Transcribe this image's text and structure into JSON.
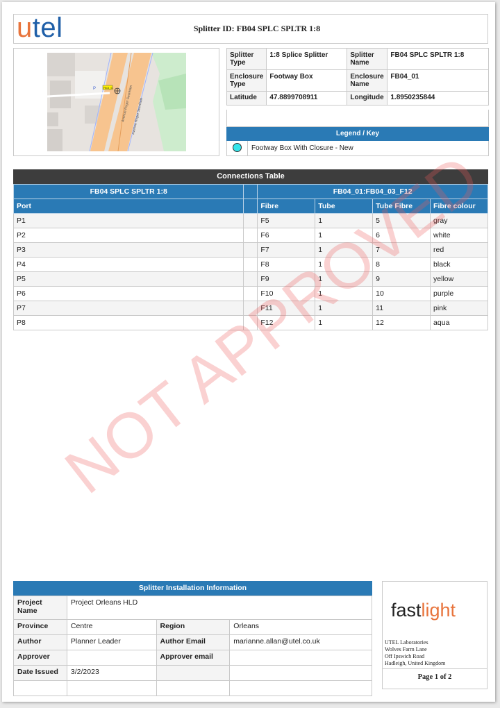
{
  "header": {
    "logo_u": "u",
    "logo_rest": "tel",
    "title": "Splitter ID: FB04 SPLC SPLTR 1:8"
  },
  "details": {
    "splitter_type_label": "Splitter Type",
    "splitter_type_value": "1:8 Splice Splitter",
    "splitter_name_label": "Splitter Name",
    "splitter_name_value": "FB04 SPLC SPLTR 1:8",
    "enclosure_type_label": "Enclosure Type",
    "enclosure_type_value": "Footway Box",
    "enclosure_name_label": "Enclosure Name",
    "enclosure_name_value": "FB04_01",
    "latitude_label": "Latitude",
    "latitude_value": "47.8899708911",
    "longitude_label": "Longitude",
    "longitude_value": "1.8950235844"
  },
  "legend": {
    "title": "Legend / Key",
    "item": "Footway Box With Closure - New",
    "symbol_color": "#35e5ea"
  },
  "connections": {
    "title": "Connections Table",
    "left_group": "FB04 SPLC SPLTR 1:8",
    "right_group": "FB04_01:FB04_03_F12",
    "columns": [
      "Port",
      "Fibre",
      "Tube",
      "Tube Fibre",
      "Fibre colour"
    ],
    "rows": [
      [
        "P1",
        "F5",
        "1",
        "5",
        "gray"
      ],
      [
        "P2",
        "F6",
        "1",
        "6",
        "white"
      ],
      [
        "P3",
        "F7",
        "1",
        "7",
        "red"
      ],
      [
        "P4",
        "F8",
        "1",
        "8",
        "black"
      ],
      [
        "P5",
        "F9",
        "1",
        "9",
        "yellow"
      ],
      [
        "P6",
        "F10",
        "1",
        "10",
        "purple"
      ],
      [
        "P7",
        "F11",
        "1",
        "11",
        "pink"
      ],
      [
        "P8",
        "F12",
        "1",
        "12",
        "aqua"
      ]
    ]
  },
  "installation": {
    "title": "Splitter Installation Information",
    "project_name_label": "Project Name",
    "project_name_value": "Project Orleans HLD",
    "province_label": "Province",
    "province_value": "Centre",
    "region_label": "Region",
    "region_value": "Orleans",
    "author_label": "Author",
    "author_value": "Planner Leader",
    "author_email_label": "Author Email",
    "author_email_value": "marianne.allan@utel.co.uk",
    "approver_label": "Approver",
    "approver_value": "",
    "approver_email_label": "Approver email",
    "approver_email_value": "",
    "date_issued_label": "Date Issued",
    "date_issued_value": "3/2/2023"
  },
  "company": {
    "logo_fast": "fast",
    "logo_light": "light",
    "address_lines": [
      "UTEL Laboratories",
      "Wolves Farm Lane",
      "Off Ipswich Road",
      "Hadleigh, United Kingdom"
    ],
    "page_number": "Page 1 of 2"
  },
  "map": {
    "road_label": "Avenue Roger Secrétain",
    "road_label_2": "Avenue Roger Secrétain",
    "parking_label": "P",
    "box_label": "FB04_01"
  },
  "watermark": "NOT APPROVED",
  "colors": {
    "accent_blue": "#2a7ab5",
    "dark_header": "#3d3d3d",
    "brand_orange": "#e8743c",
    "brand_blue": "#1f5fa8",
    "watermark": "#ec5a5a"
  }
}
